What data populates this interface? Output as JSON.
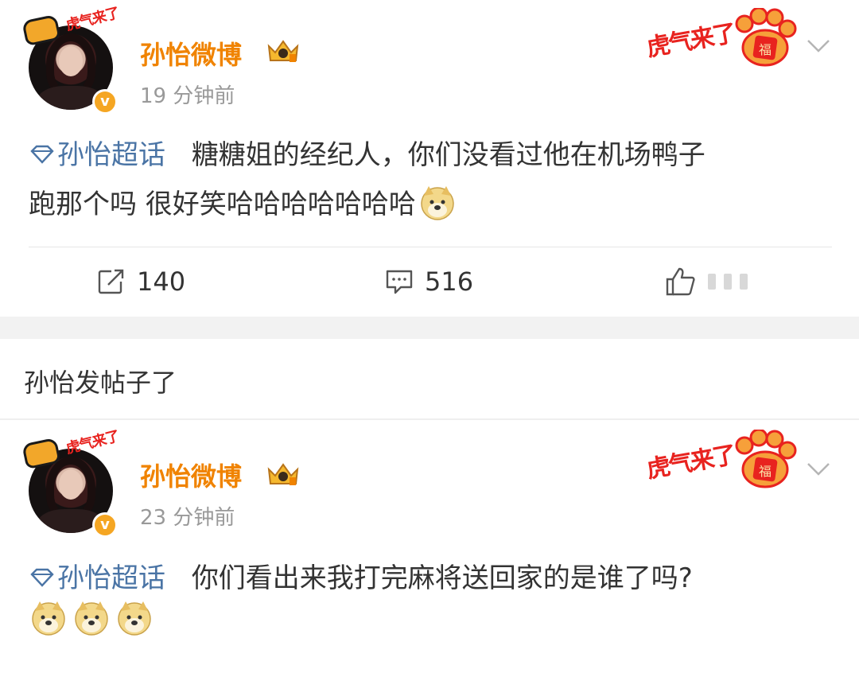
{
  "posts": [
    {
      "author": "孙怡微博",
      "time": "19 分钟前",
      "decor_text": "虎气来了",
      "avatar_tag": "虎气来了",
      "topic": "孙怡超话",
      "text_line1": "糖糖姐的经纪人，你们没看过他在机场鸭子",
      "text_line2": "跑那个吗 很好笑哈哈哈哈哈哈哈",
      "emoji": [
        "doge"
      ],
      "repost_count": "140",
      "comment_count": "516",
      "like_count": "hidden"
    },
    {
      "author": "孙怡微博",
      "time": "23 分钟前",
      "decor_text": "虎气来了",
      "avatar_tag": "虎气来了",
      "topic": "孙怡超话",
      "text_line1": "你们看出来我打完麻将送回家的是谁了吗?",
      "emoji": [
        "doge",
        "doge",
        "doge"
      ]
    }
  ],
  "section_title": "孙怡发帖子了",
  "colors": {
    "author": "#f08300",
    "topic": "#4a74a5",
    "time": "#999999",
    "brand_red": "#e8231f",
    "badge": "#f5a623"
  },
  "icons": [
    "repost-icon",
    "comment-icon",
    "like-icon",
    "chevron-down-icon",
    "diamond-topic-icon",
    "doge-emoji",
    "crown-icon",
    "verified-badge-icon",
    "tiger-paw-icon"
  ]
}
